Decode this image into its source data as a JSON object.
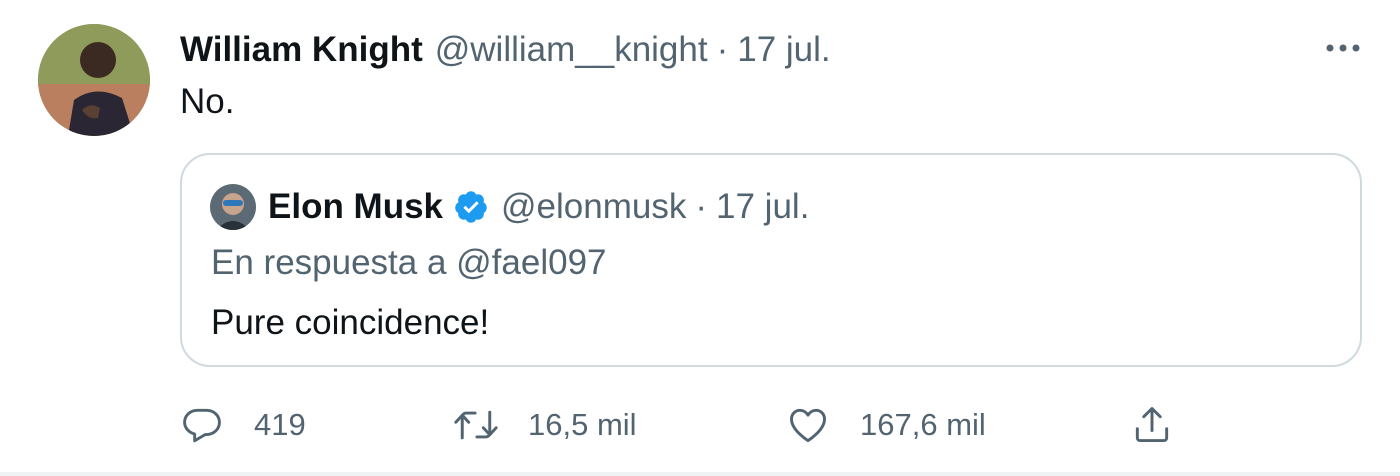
{
  "tweet": {
    "author_name": "William Knight",
    "author_handle": "@william__knight",
    "separator": "·",
    "date": "17 jul.",
    "text": "No.",
    "more_icon": "more-horizontal-icon"
  },
  "quoted": {
    "author_name": "Elon Musk",
    "author_handle": "@elonmusk",
    "separator": "·",
    "date": "17 jul.",
    "verified": true,
    "reply_to": "En respuesta a @fael097",
    "text": "Pure coincidence!"
  },
  "actions": {
    "reply_count": "419",
    "retweet_count": "16,5 mil",
    "like_count": "167,6 mil"
  },
  "colors": {
    "text": "#0f1419",
    "secondary": "#536471",
    "border": "#cfd9de",
    "verified": "#1d9bf0"
  }
}
